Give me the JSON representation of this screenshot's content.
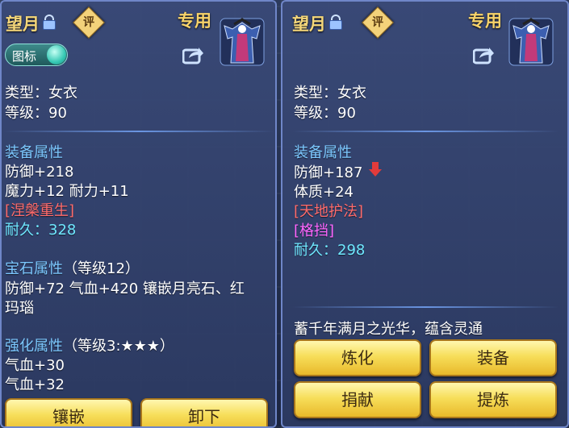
{
  "left_panel": {
    "title": "望月",
    "eval_badge": "评",
    "exclusive": "专用",
    "toggle_label": "图标",
    "type_line": "类型：女衣",
    "level_line": "等级：90",
    "equip_attr_title": "装备属性",
    "attr_lines": [
      "防御+218",
      "魔力+12 耐力+11"
    ],
    "special_skill": "[涅槃重生]",
    "durability_label": "耐久：",
    "durability_value": "328",
    "gem_attr_title": "宝石属性",
    "gem_attr_level": "（等级12）",
    "gem_line_1": "防御+72 气血+420 镶嵌月亮石、红",
    "gem_line_2": "玛瑙",
    "enhance_title": "强化属性",
    "enhance_level": "（等级3:★★★）",
    "enhance_lines": [
      "气血+30",
      "气血+32"
    ],
    "buttons": {
      "inlay": "镶嵌",
      "unload": "卸下"
    }
  },
  "right_panel": {
    "title": "望月",
    "eval_badge": "评",
    "exclusive": "专用",
    "type_line": "类型：女衣",
    "level_line": "等级：90",
    "equip_attr_title": "装备属性",
    "attr_lines": [
      "防御+187",
      "体质+24"
    ],
    "special_skill": "[天地护法]",
    "special_effect": "[格挡]",
    "durability_label": "耐久：",
    "durability_value": "298",
    "description": "蓄千年满月之光华，蕴含灵通",
    "buttons": {
      "refine": "炼化",
      "equip": "装备",
      "donate": "捐献",
      "extract": "提炼"
    }
  },
  "colors": {
    "title": "#f5d77a",
    "section": "#7cc8ff",
    "special": "#ff6b6b",
    "effect": "#ff66ff",
    "durability": "#6fe8ff",
    "button": "#f7de5a"
  },
  "icons": [
    "lock-icon",
    "eval-badge-icon",
    "robe-item-icon",
    "share-icon",
    "toggle-switch",
    "arrow-down-icon"
  ]
}
